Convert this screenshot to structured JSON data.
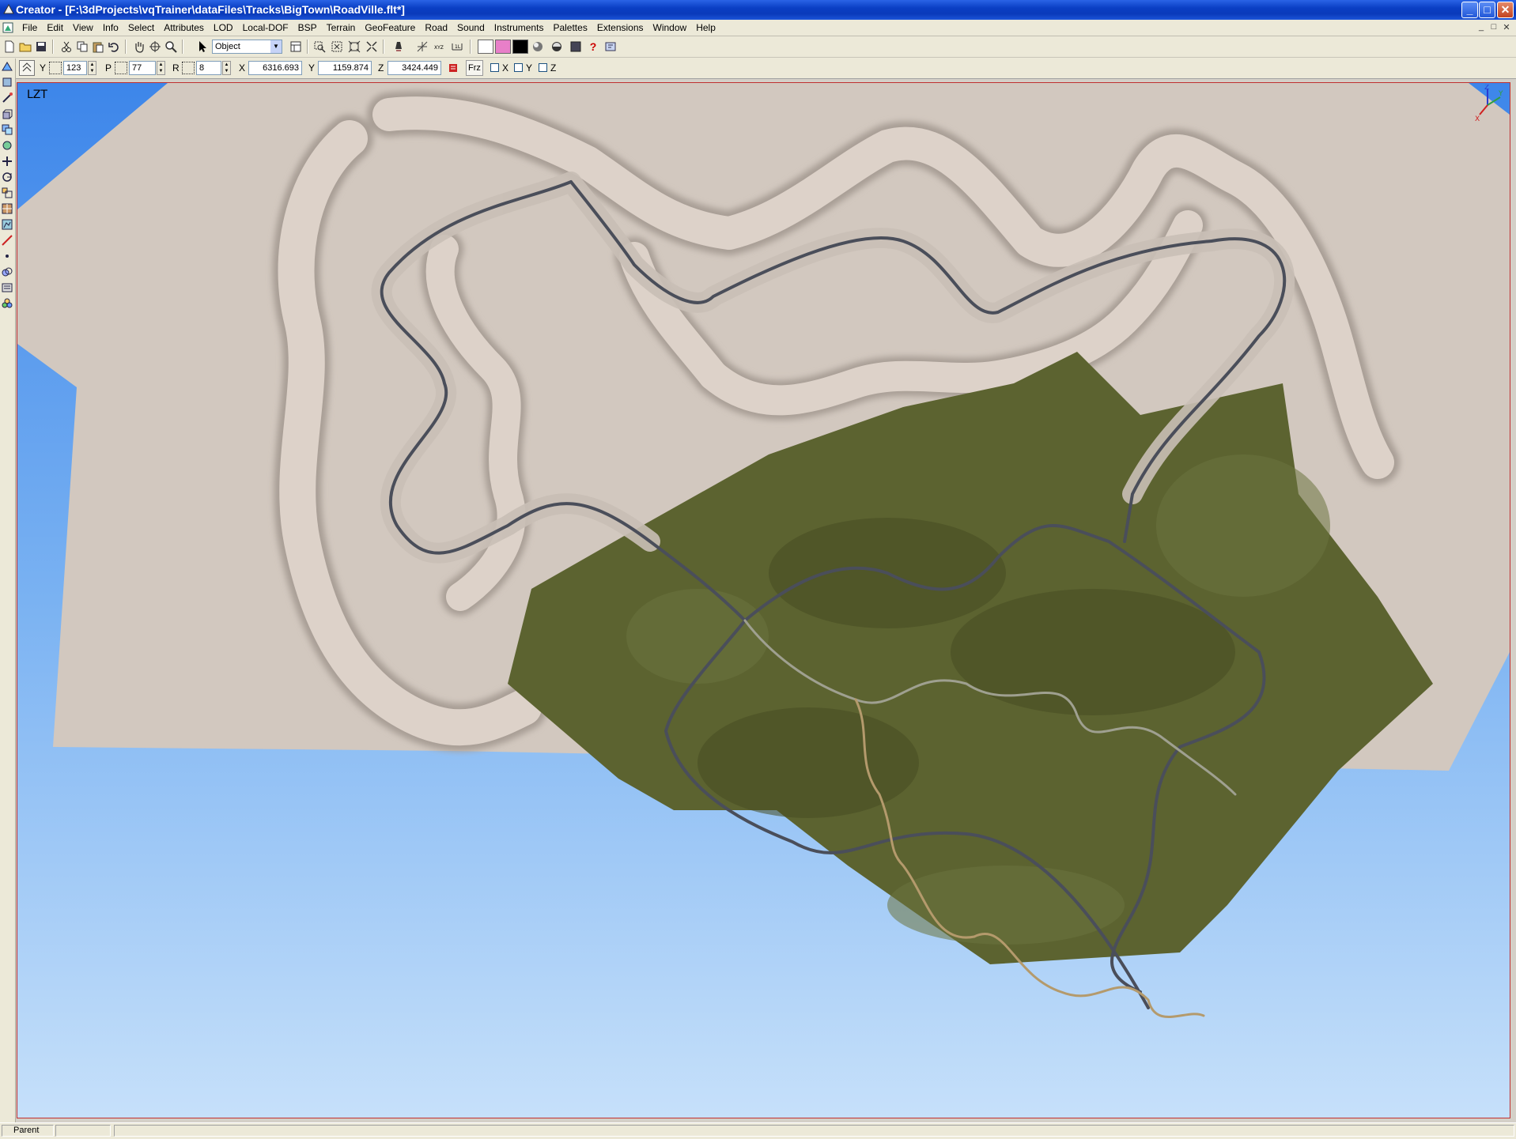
{
  "window": {
    "title": "Creator - [F:\\3dProjects\\vqTrainer\\dataFiles\\Tracks\\BigTown\\RoadVille.flt*]",
    "controls": {
      "minimize": "_",
      "maximize": "□",
      "close": "✕"
    }
  },
  "menu": {
    "items": [
      "File",
      "Edit",
      "View",
      "Info",
      "Select",
      "Attributes",
      "LOD",
      "Local-DOF",
      "BSP",
      "Terrain",
      "GeoFeature",
      "Road",
      "Sound",
      "Instruments",
      "Palettes",
      "Extensions",
      "Window",
      "Help"
    ],
    "mdi_controls": [
      "_",
      "□",
      "✕"
    ]
  },
  "toolbar": {
    "select_mode": "Object",
    "swatch_colors": [
      "#ffffff",
      "#e87fc8",
      "#000000"
    ],
    "frz_label": "Frz",
    "help_glyph": "?"
  },
  "transform": {
    "y_label": "Y",
    "y_value": "123",
    "p_label": "P",
    "p_value": "77",
    "r_label": "R",
    "r_value": "8",
    "x_coord_label": "X",
    "x_coord": "6316.693",
    "y_coord_label": "Y",
    "y_coord": "1159.874",
    "z_coord_label": "Z",
    "z_coord": "3424.449",
    "lock_x": "X",
    "lock_y": "Y",
    "lock_z": "Z"
  },
  "viewport": {
    "label": "LZT",
    "axis": {
      "x": "X",
      "y": "Y",
      "z": "Z"
    },
    "colors": {
      "sky_top": "#3d86ea",
      "sky_bottom": "#c6e0fa",
      "sand": "#d2c8bf",
      "grass": "#5c6330",
      "road": "#4a4e5a"
    }
  },
  "status": {
    "parent": "Parent"
  }
}
